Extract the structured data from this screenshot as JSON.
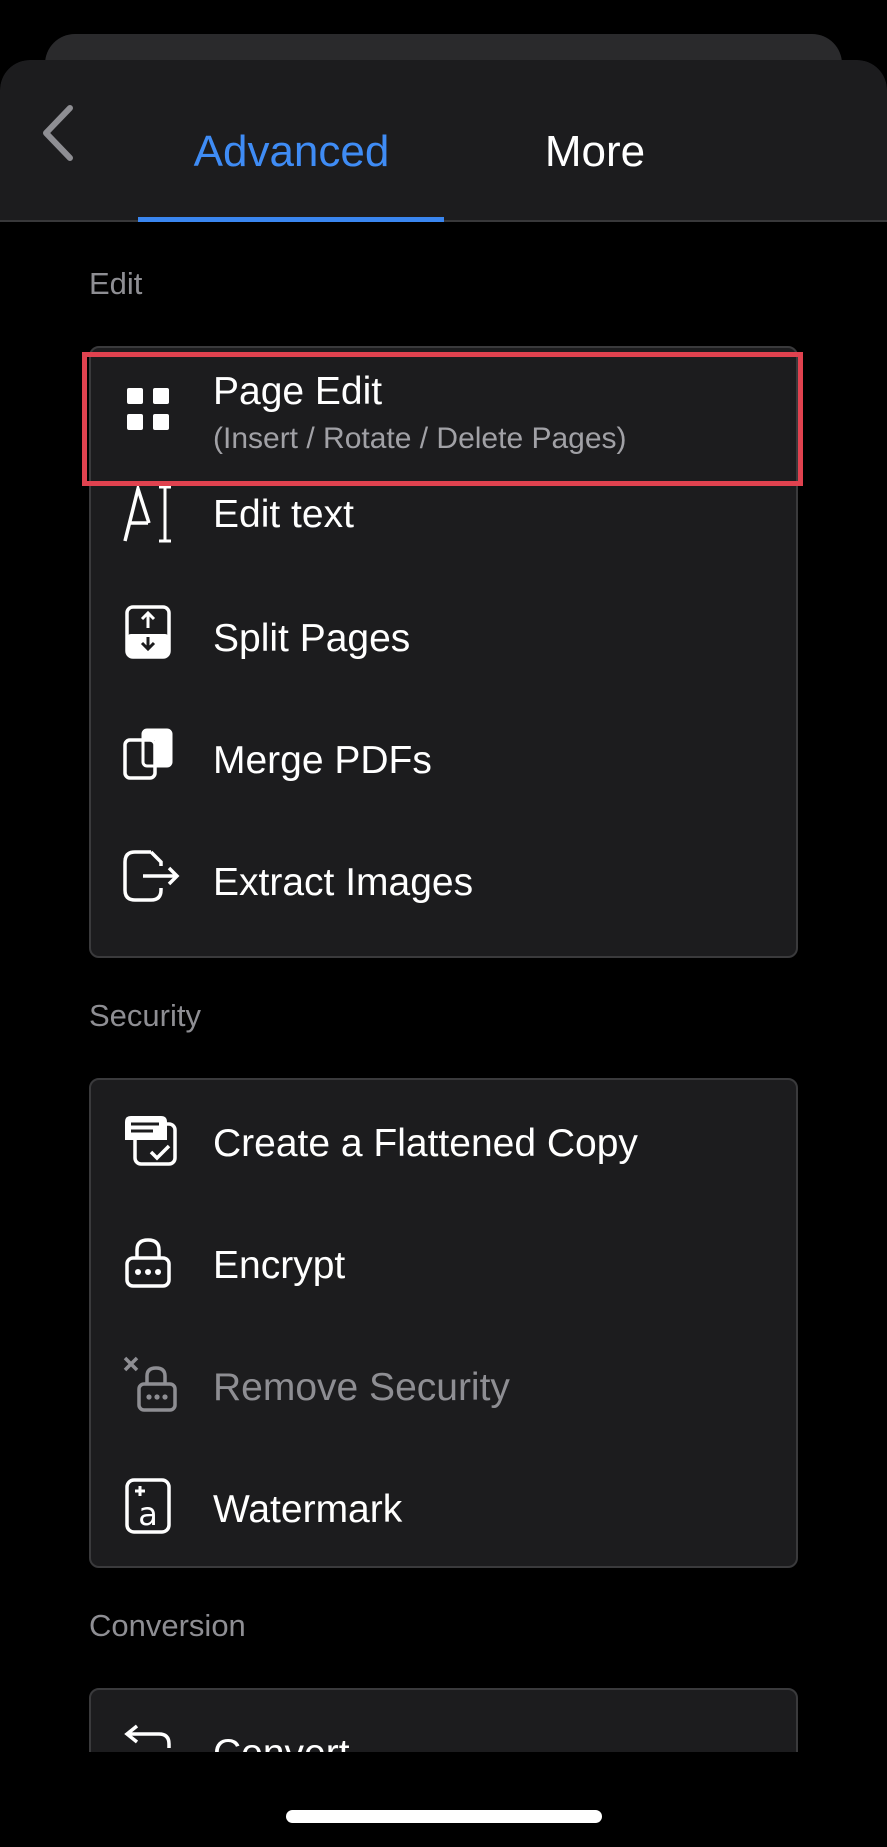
{
  "header": {
    "tabs": [
      {
        "label": "Advanced",
        "active": true
      },
      {
        "label": "More",
        "active": false
      }
    ],
    "accent_color": "#3f8cf5"
  },
  "sections": {
    "edit": {
      "label": "Edit",
      "items": [
        {
          "title": "Page Edit",
          "subtitle": "(Insert / Rotate / Delete Pages)",
          "icon": "grid-icon"
        },
        {
          "title": "Edit text",
          "icon": "edit-text-icon"
        },
        {
          "title": "Split Pages",
          "icon": "split-pages-icon"
        },
        {
          "title": "Merge PDFs",
          "icon": "merge-pdfs-icon"
        },
        {
          "title": "Extract Images",
          "icon": "export-icon"
        }
      ]
    },
    "security": {
      "label": "Security",
      "items": [
        {
          "title": "Create a Flattened Copy",
          "icon": "flattened-copy-icon"
        },
        {
          "title": "Encrypt",
          "icon": "lock-icon"
        },
        {
          "title": "Remove Security",
          "icon": "unlock-icon",
          "disabled": true
        },
        {
          "title": "Watermark",
          "icon": "watermark-icon"
        }
      ]
    },
    "conversion": {
      "label": "Conversion",
      "items": [
        {
          "title": "Convert",
          "icon": "convert-icon"
        }
      ]
    }
  }
}
